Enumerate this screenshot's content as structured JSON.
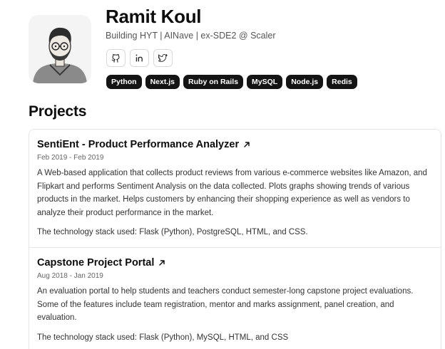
{
  "profile": {
    "name": "Ramit Koul",
    "tagline": "Building HYT | AINave | ex-SDE2 @ Scaler",
    "socials": [
      {
        "icon": "github-icon"
      },
      {
        "icon": "linkedin-icon"
      },
      {
        "icon": "twitter-icon"
      }
    ],
    "skills": [
      "Python",
      "Next.js",
      "Ruby on Rails",
      "MySQL",
      "Node.js",
      "Redis"
    ]
  },
  "projects_section": {
    "title": "Projects",
    "items": [
      {
        "title": "SentiEnt - Product Performance Analyzer",
        "dates": "Feb 2019 - Feb 2019",
        "description": "A Web-based application that collects product reviews from various e-commerce websites like Amazon, and Flipkart and performs Sentiment Analysis on the data collected. Plots graphs showing trends of various products in the market. Helps customers by enhancing their shopping experience as well as vendors to analyze their product performance in the market.",
        "stack": "The technology stack used: Flask (Python), PostgreSQL, HTML, and CSS."
      },
      {
        "title": "Capstone Project Portal",
        "dates": "Aug 2018 - Jan 2019",
        "description": "An evaluation portal to help students and teachers conduct semester-long capstone project evaluations. Some of the features include team registration, mentor and marks assignment, panel creation, and evaluation.",
        "stack": "The technology stack used: Flask (Python), MySQL, HTML, and CSS"
      }
    ]
  }
}
